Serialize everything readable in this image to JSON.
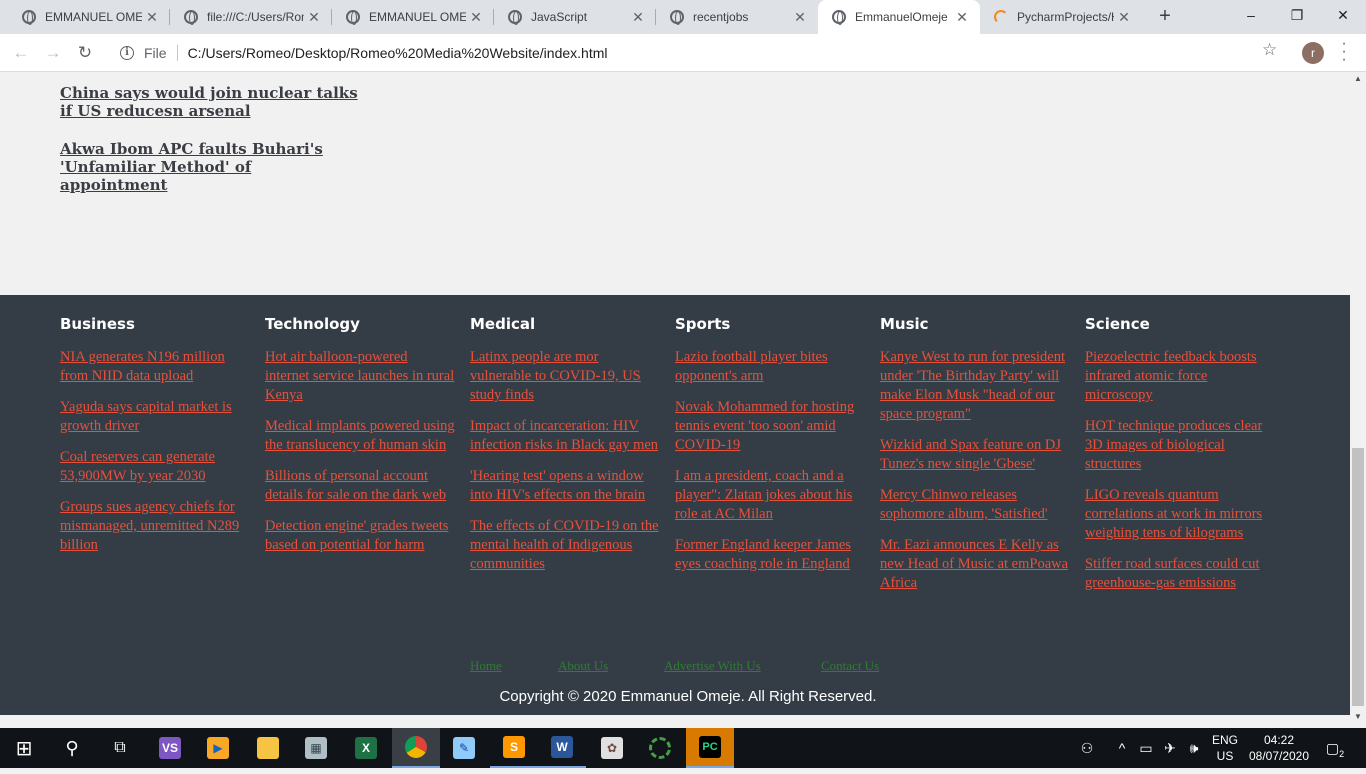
{
  "browser": {
    "tabs": [
      {
        "title": "EMMANUEL OMEJE",
        "icon": "globe-icon",
        "active": false
      },
      {
        "title": "file:///C:/Users/Romeo",
        "icon": "globe-icon",
        "active": false
      },
      {
        "title": "EMMANUEL OMEJE",
        "icon": "globe-icon",
        "active": false
      },
      {
        "title": "JavaScript",
        "icon": "globe-icon",
        "active": false
      },
      {
        "title": "recentjobs",
        "icon": "globe-icon",
        "active": false
      },
      {
        "title": "EmmanuelOmeje",
        "icon": "globe-icon",
        "active": true
      },
      {
        "title": "PycharmProjects/H",
        "icon": "loading-spinner-icon",
        "active": false
      }
    ],
    "new_tab_label": "+",
    "window_controls": {
      "minimize": "–",
      "restore": "❐",
      "close": "✕"
    },
    "toolbar": {
      "back": "←",
      "forward": "→",
      "reload": "↻",
      "scheme_label": "File",
      "url": "C:/Users/Romeo/Desktop/Romeo%20Media%20Website/index.html",
      "avatar_letter": "r"
    }
  },
  "page": {
    "headlines": [
      "China says would join nuclear talks if US reducesn arsenal",
      "Akwa Ibom APC faults Buhari's 'Unfamiliar Method' of appointment"
    ],
    "footer": {
      "columns": [
        {
          "heading": "Business",
          "links": [
            "NIA generates N196 million from NIID data upload",
            "Yaguda says capital market is growth driver",
            "Coal reserves can generate 53,900MW by year 2030",
            "Groups sues agency chiefs for mismanaged, unremitted N289 billion"
          ]
        },
        {
          "heading": "Technology",
          "links": [
            "Hot air balloon-powered internet service launches in rural Kenya",
            "Medical implants powered using the translucency of human skin",
            "Billions of personal account details for sale on the dark web",
            "Detection engine' grades tweets based on potential for harm"
          ]
        },
        {
          "heading": "Medical",
          "links": [
            "Latinx people are mor vulnerable to COVID-19, US study finds",
            "Impact of incarceration: HIV infection risks in Black gay men",
            "'Hearing test' opens a window into HIV's effects on the brain",
            "The effects of COVID-19 on the mental health of Indigenous communities"
          ]
        },
        {
          "heading": "Sports",
          "links": [
            "Lazio football player bites opponent's arm",
            "Novak Mohammed for hosting tennis event 'too soon' amid COVID-19",
            "I am a president, coach and a player\": Zlatan jokes about his role at AC Milan",
            "Former England keeper James eyes coaching role in England"
          ]
        },
        {
          "heading": "Music",
          "links": [
            "Kanye West to run for president under 'The Birthday Party' will make Elon Musk \"head of our space program\"",
            "Wizkid and Spax feature on DJ Tunez's new single 'Gbese'",
            "Mercy Chinwo releases sophomore album, 'Satisfied'",
            "Mr. Eazi announces E Kelly as new Head of Music at emPoawa Africa"
          ]
        },
        {
          "heading": "Science",
          "links": [
            "Piezoelectric feedback boosts infrared atomic force microscopy",
            "HOT technique produces clear 3D images of biological structures",
            "LIGO reveals quantum correlations at work in mirrors weighing tens of kilograms",
            "Stiffer road surfaces could cut greenhouse-gas emissions"
          ]
        }
      ],
      "nav": [
        "Home",
        "About Us",
        "Advertise With Us",
        "Contact Us"
      ],
      "copyright": "Copyright © 2020 Emmanuel Omeje. All Right Reserved."
    }
  },
  "taskbar": {
    "apps": [
      {
        "name": "windows-start-icon",
        "glyph": "⊞"
      },
      {
        "name": "search-icon",
        "glyph": "⚲"
      },
      {
        "name": "task-view-icon",
        "glyph": "⧉"
      },
      {
        "name": "visual-studio-icon",
        "glyph": "VS"
      },
      {
        "name": "media-player-icon",
        "glyph": "▶"
      },
      {
        "name": "file-explorer-icon",
        "glyph": "▬"
      },
      {
        "name": "calculator-icon",
        "glyph": "▦"
      },
      {
        "name": "excel-icon",
        "glyph": "X"
      },
      {
        "name": "chrome-icon",
        "glyph": "●"
      },
      {
        "name": "notepad-icon",
        "glyph": "✎"
      },
      {
        "name": "sublime-text-icon",
        "glyph": "S"
      },
      {
        "name": "word-icon",
        "glyph": "W"
      },
      {
        "name": "paint-icon",
        "glyph": "🎨"
      },
      {
        "name": "app-ring-icon",
        "glyph": "◌"
      },
      {
        "name": "pycharm-icon",
        "glyph": "PC"
      }
    ],
    "tray": {
      "lang_line1": "ENG",
      "lang_line2": "US",
      "time": "04:22",
      "date": "08/07/2020",
      "notification_count": "2"
    }
  },
  "colors": {
    "footer_bg": "#343d46",
    "link_color": "#e8503a",
    "nav_color": "#2e7d32",
    "page_bg": "#f1f1f1"
  }
}
